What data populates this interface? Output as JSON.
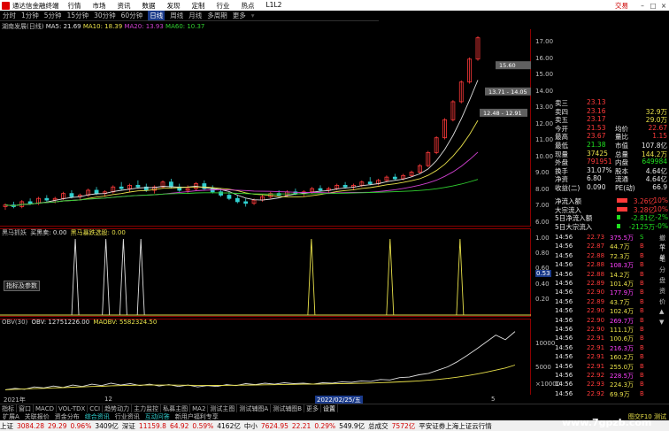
{
  "window": {
    "title": "通达信金融终端",
    "menu": [
      "行情",
      "市场",
      "资讯",
      "数据",
      "发现",
      "定制",
      "行业",
      "热点",
      "L1L2"
    ],
    "trade_label": "交易"
  },
  "period_tabs": [
    "分时",
    "1分钟",
    "5分钟",
    "15分钟",
    "30分钟",
    "日线",
    "周线",
    "月线",
    "多周期",
    "更多"
  ],
  "selected_period": "日线",
  "chart_header": {
    "stock": "湖南发展(日线)",
    "ma5": "MA5: 21.69",
    "ma10": "MA10: 18.39",
    "ma20": "MA20: 13.93",
    "ma60": "MA60: 10.37"
  },
  "price_axis": [
    "17.00",
    "16.00",
    "15.00",
    "14.00",
    "13.00",
    "12.00",
    "11.00",
    "10.00",
    "9.00",
    "8.00",
    "7.00",
    "6.00"
  ],
  "price_annotations": [
    "13.71 - 14.05",
    "12.48 - 12.91",
    "15.60"
  ],
  "panel2": {
    "label": "黑马抓妖",
    "buy": "买黑卖: 0.00",
    "sig": "黑马暴跌选股: 0.00",
    "axis": [
      "1.00",
      "0.80",
      "0.60",
      "0.40",
      "0.20"
    ],
    "marker": "0.53",
    "button": "指标及参数"
  },
  "panel3": {
    "label": "OBV(30)",
    "obv": "OBV: 12751226.00",
    "maobv": "MAOBV: 5582324.50",
    "axis": [
      "10000",
      "5000"
    ],
    "unit": "×10000"
  },
  "dates": {
    "left": "2021年",
    "mid": "12",
    "hl": "2022/02/25/五",
    "right": "5"
  },
  "quote_rows": [
    {
      "k": "卖三",
      "v": "23.13",
      "c": "red",
      "v2": "",
      "c2": "red"
    },
    {
      "k": "卖四",
      "v": "23.16",
      "c": "red",
      "v2": "32.9万",
      "c2": "yel"
    },
    {
      "k": "卖五",
      "v": "23.17",
      "c": "red",
      "v2": "29.0万",
      "c2": "yel"
    },
    {
      "k": "今开",
      "v": "21.53",
      "c": "red",
      "k2": "均价",
      "v2": "22.67",
      "c2": "red"
    },
    {
      "k": "最高",
      "v": "23.67",
      "c": "red",
      "k2": "量比",
      "v2": "1.15",
      "c2": "red"
    },
    {
      "k": "最低",
      "v": "21.38",
      "c": "green",
      "k2": "市值",
      "v2": "107.8亿",
      "c2": "white"
    },
    {
      "k": "现量",
      "v": "37425",
      "c": "yel",
      "k2": "总量",
      "v2": "144.2万",
      "c2": "yel"
    },
    {
      "k": "外盘",
      "v": "791951",
      "c": "red",
      "k2": "内盘",
      "v2": "649984",
      "c2": "green"
    },
    {
      "k": "换手",
      "v": "31.07%",
      "c": "white",
      "k2": "股本",
      "v2": "4.64亿",
      "c2": "white"
    },
    {
      "k": "净资",
      "v": "6.80",
      "c": "white",
      "k2": "流通",
      "v2": "4.64亿",
      "c2": "white"
    },
    {
      "k": "收益(二)",
      "v": "0.090",
      "c": "white",
      "k2": "PE(动)",
      "v2": "66.9",
      "c2": "white"
    }
  ],
  "fund_rows": [
    {
      "k": "净流入额",
      "v": "3.26亿",
      "p": "10%",
      "c": "red"
    },
    {
      "k": "大宗流入",
      "v": "3.28亿",
      "p": "10%",
      "c": "red"
    },
    {
      "k": "5日净流入额",
      "v": "-2.81亿",
      "p": "-2%",
      "c": "green"
    },
    {
      "k": "5日大宗流入",
      "v": "-2125万",
      "p": "-0%",
      "c": "green"
    }
  ],
  "tick_rows": [
    {
      "t": "14:56",
      "p": "22.73",
      "v": "375.5万",
      "b": "S"
    },
    {
      "t": "14:56",
      "p": "22.87",
      "v": "44.7万",
      "b": "B"
    },
    {
      "t": "14:56",
      "p": "22.88",
      "v": "72.3万",
      "b": "B"
    },
    {
      "t": "14:56",
      "p": "22.88",
      "v": "108.3万",
      "b": "B"
    },
    {
      "t": "14:56",
      "p": "22.88",
      "v": "14.2万",
      "b": "B"
    },
    {
      "t": "14:56",
      "p": "22.89",
      "v": "101.4万",
      "b": "B"
    },
    {
      "t": "14:56",
      "p": "22.90",
      "v": "177.9万",
      "b": "B"
    },
    {
      "t": "14:56",
      "p": "22.89",
      "v": "43.7万",
      "b": "B"
    },
    {
      "t": "14:56",
      "p": "22.90",
      "v": "102.4万",
      "b": "B"
    },
    {
      "t": "14:56",
      "p": "22.90",
      "v": "269.7万",
      "b": "B"
    },
    {
      "t": "14:56",
      "p": "22.90",
      "v": "111.1万",
      "b": "B"
    },
    {
      "t": "14:56",
      "p": "22.91",
      "v": "100.6万",
      "b": "B"
    },
    {
      "t": "14:56",
      "p": "22.91",
      "v": "216.3万",
      "b": "B"
    },
    {
      "t": "14:56",
      "p": "22.91",
      "v": "160.2万",
      "b": "B"
    },
    {
      "t": "14:56",
      "p": "22.91",
      "v": "255.0万",
      "b": "B"
    },
    {
      "t": "14:56",
      "p": "22.92",
      "v": "228.5万",
      "b": "B"
    },
    {
      "t": "14:56",
      "p": "22.93",
      "v": "224.3万",
      "b": "B"
    },
    {
      "t": "14:56",
      "p": "22.92",
      "v": "69.9万",
      "b": "B"
    }
  ],
  "indicator_tabs": [
    "指标",
    "窗口",
    "MACD",
    "VOL-TDX",
    "CCI",
    "趋势动力",
    "主力监控",
    "私募主图",
    "MA2",
    "测试主图",
    "测试辅图A",
    "测试辅图B",
    "更多",
    "设置"
  ],
  "sub_tabs": [
    "扩展A",
    "关联报价",
    "资金分布",
    "综合资讯",
    "行业资讯",
    "互动问答",
    "新用户福利专享"
  ],
  "sub_right": [
    "图交F10",
    "测试"
  ],
  "status": [
    {
      "label": "上证",
      "val": "3084.28",
      "chg": "29.29",
      "pct": "0.96%",
      "amt": "3409亿",
      "c": "r"
    },
    {
      "label": "深证",
      "val": "11159.8",
      "chg": "64.92",
      "pct": "0.59%",
      "amt": "4162亿",
      "c": "r"
    },
    {
      "label": "中小",
      "val": "7624.95",
      "chg": "22.21",
      "pct": "0.29%",
      "amt": "549.9亿",
      "c": "r"
    }
  ],
  "status_extra": [
    "总成交",
    "7572亿",
    "平安证券上海上证云行情"
  ],
  "watermark": "www.7gpzb.com",
  "side_tabs": [
    "撤单",
    "下单",
    "笔",
    "分",
    "盘",
    "资",
    "价",
    "▲",
    "▼"
  ],
  "chart_data": [
    {
      "type": "candlestick",
      "title": "湖南发展(日线)",
      "ylim": [
        6,
        17.5
      ],
      "series": [
        {
          "name": "MA5",
          "values": []
        },
        {
          "name": "MA10",
          "values": []
        },
        {
          "name": "MA20",
          "values": []
        },
        {
          "name": "MA60",
          "values": []
        }
      ],
      "ohlc": [
        [
          7.0,
          7.2,
          6.8,
          7.1
        ],
        [
          7.1,
          7.3,
          6.9,
          7.0
        ],
        [
          7.0,
          7.4,
          6.9,
          7.3
        ],
        [
          7.3,
          7.5,
          7.1,
          7.2
        ],
        [
          7.2,
          7.6,
          7.1,
          7.5
        ],
        [
          7.5,
          7.7,
          7.3,
          7.4
        ],
        [
          7.4,
          7.6,
          7.2,
          7.5
        ],
        [
          7.5,
          7.9,
          7.4,
          7.8
        ],
        [
          7.8,
          8.0,
          7.5,
          7.6
        ],
        [
          7.6,
          7.8,
          7.4,
          7.7
        ],
        [
          7.7,
          8.1,
          7.6,
          8.0
        ],
        [
          8.0,
          8.2,
          7.7,
          7.8
        ],
        [
          7.8,
          8.0,
          7.6,
          7.9
        ],
        [
          7.9,
          8.3,
          7.8,
          8.2
        ],
        [
          8.2,
          8.5,
          8.0,
          8.1
        ],
        [
          8.1,
          8.4,
          7.9,
          8.3
        ],
        [
          8.3,
          8.6,
          8.1,
          8.2
        ],
        [
          8.2,
          8.4,
          7.9,
          8.0
        ],
        [
          8.0,
          8.3,
          7.8,
          8.2
        ],
        [
          8.2,
          8.6,
          8.1,
          8.5
        ],
        [
          8.5,
          8.7,
          8.1,
          8.2
        ],
        [
          8.2,
          8.4,
          7.9,
          8.0
        ],
        [
          8.0,
          8.3,
          7.8,
          8.1
        ],
        [
          8.1,
          8.5,
          8.0,
          8.4
        ],
        [
          8.4,
          8.6,
          8.0,
          8.1
        ],
        [
          8.1,
          8.3,
          7.8,
          7.9
        ],
        [
          7.9,
          8.1,
          7.6,
          7.7
        ],
        [
          7.7,
          7.9,
          7.4,
          7.5
        ],
        [
          7.5,
          7.7,
          7.2,
          7.3
        ],
        [
          7.3,
          7.5,
          7.0,
          7.2
        ],
        [
          7.2,
          7.5,
          7.1,
          7.4
        ],
        [
          7.4,
          7.7,
          7.3,
          7.6
        ],
        [
          7.6,
          7.9,
          7.5,
          7.8
        ],
        [
          7.8,
          8.0,
          7.6,
          7.7
        ],
        [
          7.7,
          8.0,
          7.6,
          7.9
        ],
        [
          7.9,
          8.1,
          7.7,
          7.8
        ],
        [
          7.8,
          8.0,
          7.6,
          7.9
        ],
        [
          7.9,
          8.2,
          7.8,
          8.1
        ],
        [
          8.1,
          8.3,
          7.9,
          8.0
        ],
        [
          8.0,
          8.2,
          7.8,
          8.1
        ],
        [
          8.1,
          8.4,
          8.0,
          8.3
        ],
        [
          8.3,
          8.5,
          8.1,
          8.2
        ],
        [
          8.2,
          8.4,
          8.0,
          8.3
        ],
        [
          8.3,
          8.6,
          8.2,
          8.5
        ],
        [
          8.5,
          8.8,
          8.3,
          8.4
        ],
        [
          8.4,
          8.7,
          8.3,
          8.6
        ],
        [
          8.6,
          8.9,
          8.5,
          8.8
        ],
        [
          8.8,
          9.0,
          8.6,
          8.7
        ],
        [
          8.7,
          9.0,
          8.6,
          8.9
        ],
        [
          8.9,
          9.2,
          8.8,
          9.1
        ],
        [
          9.1,
          9.6,
          9.0,
          9.5
        ],
        [
          9.5,
          10.4,
          9.4,
          10.3
        ],
        [
          10.3,
          11.3,
          10.2,
          11.2
        ],
        [
          11.2,
          12.4,
          11.1,
          12.3
        ],
        [
          12.3,
          13.5,
          12.2,
          13.4
        ],
        [
          13.4,
          14.7,
          13.3,
          14.6
        ],
        [
          14.6,
          16.1,
          14.5,
          16.0
        ],
        [
          16.0,
          17.4,
          15.9,
          17.3
        ]
      ]
    },
    {
      "type": "line",
      "title": "黑马抓妖",
      "ylim": [
        0,
        1
      ],
      "series": [
        {
          "name": "买黑卖",
          "values": [
            0,
            0,
            0,
            0,
            0,
            0,
            0,
            0,
            0,
            0,
            0,
            0,
            0,
            0,
            0,
            0,
            1,
            0,
            0,
            0,
            0,
            0,
            0,
            1,
            0,
            0,
            0,
            1,
            0,
            0,
            0,
            1,
            0,
            0,
            0,
            0,
            0,
            0,
            0,
            0,
            0,
            0,
            0,
            0,
            0,
            0,
            0,
            0,
            0,
            0,
            0,
            0,
            0,
            0,
            0,
            0,
            0,
            0,
            0,
            0,
            0,
            0,
            0,
            0,
            0,
            0,
            0,
            0,
            0,
            0,
            1,
            0,
            0,
            0,
            0,
            0,
            0,
            0,
            0,
            0,
            0,
            0,
            0,
            0,
            0,
            0,
            0,
            0,
            1,
            0,
            0,
            0,
            0,
            0,
            0,
            0,
            0,
            0,
            0,
            0,
            0,
            0,
            0,
            0,
            1,
            0,
            0,
            0,
            0,
            0,
            0,
            0,
            0,
            0,
            0,
            0,
            0,
            0,
            0,
            0
          ]
        },
        {
          "name": "黑马暴跌选股",
          "values": [
            0,
            0,
            0,
            0,
            0,
            0,
            0,
            0,
            0,
            0,
            0,
            0,
            0,
            0,
            0,
            0,
            0,
            0,
            0,
            0,
            0,
            0,
            0,
            0,
            0,
            0,
            0,
            0,
            0,
            0,
            0,
            0,
            0,
            0,
            0,
            0,
            0,
            0,
            0,
            0,
            0,
            0,
            0,
            0,
            0,
            0,
            0,
            0,
            0,
            0,
            0,
            0,
            0,
            0,
            0,
            0,
            0,
            0,
            0,
            0,
            0,
            0,
            0,
            0,
            0,
            0,
            0,
            0,
            0,
            0,
            0,
            0,
            0,
            0,
            0,
            0,
            0,
            0,
            0,
            0,
            0,
            0,
            0,
            0,
            0,
            0,
            0,
            0,
            0,
            0,
            0,
            0,
            0,
            0,
            0,
            0,
            0,
            0,
            0,
            0,
            0,
            0,
            0,
            0,
            0,
            0,
            0,
            0,
            0,
            0,
            0,
            0,
            0,
            0,
            0,
            0,
            0,
            0,
            0,
            0
          ]
        }
      ]
    },
    {
      "type": "line",
      "title": "OBV(30)",
      "ylim": [
        0,
        14000
      ],
      "series": [
        {
          "name": "OBV",
          "values": [
            300,
            600,
            400,
            900,
            700,
            1100,
            800,
            1300,
            1000,
            1500,
            1200,
            1700,
            1300,
            1600,
            1200,
            1500,
            1100,
            1400,
            1000,
            1300,
            900,
            1200,
            1000,
            1400,
            1200,
            1600,
            1400,
            1700,
            1500,
            1800,
            1600,
            1700,
            1500,
            1800,
            1700,
            2000,
            1900,
            2200,
            2100,
            2500,
            2400,
            2900,
            3000,
            3500,
            3800,
            4500,
            5200,
            6300,
            7600,
            9000,
            10500,
            12000,
            11000,
            12751
          ]
        },
        {
          "name": "MAOBV",
          "values": [
            300,
            400,
            450,
            550,
            600,
            700,
            750,
            850,
            900,
            1000,
            1050,
            1150,
            1200,
            1250,
            1280,
            1300,
            1300,
            1300,
            1280,
            1270,
            1250,
            1240,
            1230,
            1250,
            1260,
            1290,
            1320,
            1360,
            1390,
            1430,
            1460,
            1490,
            1510,
            1540,
            1570,
            1610,
            1650,
            1700,
            1750,
            1820,
            1890,
            1980,
            2080,
            2200,
            2340,
            2520,
            2720,
            2980,
            3300,
            3650,
            4050,
            4500,
            4950,
            5582
          ]
        }
      ]
    }
  ]
}
